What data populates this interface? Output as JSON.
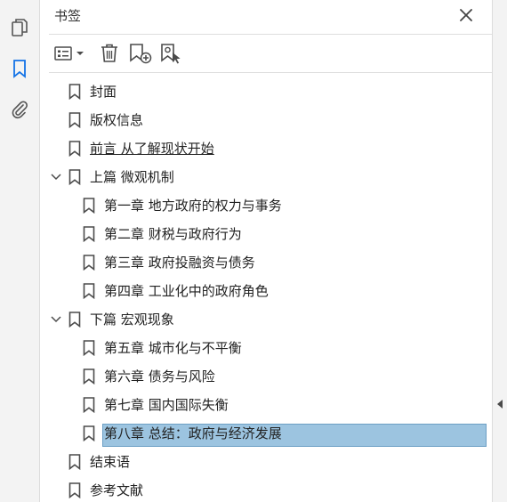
{
  "panel": {
    "title": "书签",
    "close_icon": "close-icon"
  },
  "rail": {
    "icons": [
      "pages-icon",
      "bookmark-icon",
      "attachment-icon"
    ],
    "active": "bookmark-icon"
  },
  "toolbar": {
    "icons": [
      "options-menu-icon",
      "delete-icon",
      "new-bookmark-icon",
      "new-bookmark-from-structure-icon"
    ]
  },
  "bookmarks": [
    {
      "label": "封面",
      "level": 0,
      "expandable": false
    },
    {
      "label": "版权信息",
      "level": 0,
      "expandable": false
    },
    {
      "label": "前言 从了解现状开始",
      "level": 0,
      "expandable": false,
      "underline": true
    },
    {
      "label": "上篇 微观机制",
      "level": 0,
      "expandable": true,
      "expanded": true
    },
    {
      "label": "第一章 地方政府的权力与事务",
      "level": 1,
      "expandable": false
    },
    {
      "label": "第二章 财税与政府行为",
      "level": 1,
      "expandable": false
    },
    {
      "label": "第三章 政府投融资与债务",
      "level": 1,
      "expandable": false
    },
    {
      "label": "第四章 工业化中的政府角色",
      "level": 1,
      "expandable": false
    },
    {
      "label": "下篇 宏观现象",
      "level": 0,
      "expandable": true,
      "expanded": true
    },
    {
      "label": "第五章 城市化与不平衡",
      "level": 1,
      "expandable": false
    },
    {
      "label": "第六章 债务与风险",
      "level": 1,
      "expandable": false
    },
    {
      "label": "第七章 国内国际失衡",
      "level": 1,
      "expandable": false
    },
    {
      "label": "第八章 总结：政府与经济发展",
      "level": 1,
      "expandable": false,
      "selected": true
    },
    {
      "label": "结束语",
      "level": 0,
      "expandable": false
    },
    {
      "label": "参考文献",
      "level": 0,
      "expandable": false
    }
  ],
  "colors": {
    "accent": "#1473e6",
    "selection": "#9cc4e0",
    "icon": "#4b4b4b"
  }
}
